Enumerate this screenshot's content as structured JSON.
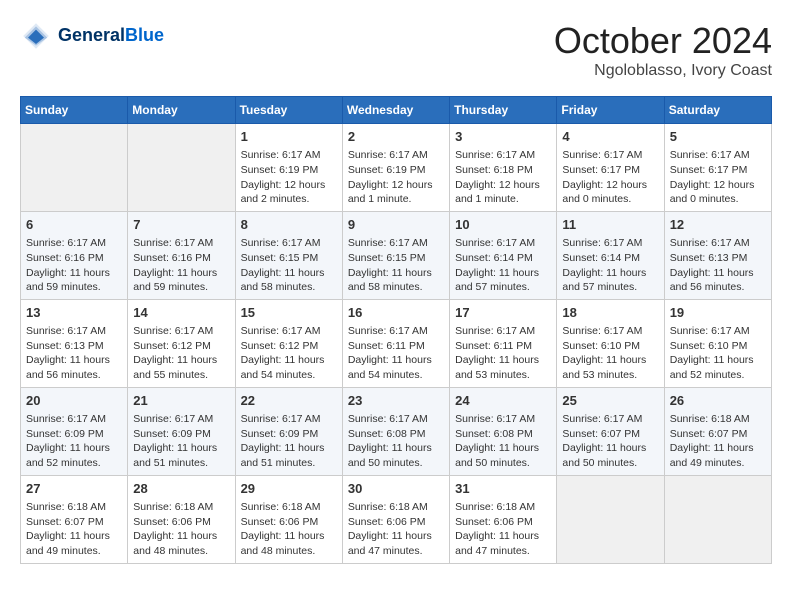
{
  "header": {
    "logo_line1": "General",
    "logo_line2": "Blue",
    "title": "October 2024",
    "subtitle": "Ngoloblasso, Ivory Coast"
  },
  "weekdays": [
    "Sunday",
    "Monday",
    "Tuesday",
    "Wednesday",
    "Thursday",
    "Friday",
    "Saturday"
  ],
  "weeks": [
    [
      {
        "day": "",
        "info": ""
      },
      {
        "day": "",
        "info": ""
      },
      {
        "day": "1",
        "info": "Sunrise: 6:17 AM\nSunset: 6:19 PM\nDaylight: 12 hours\nand 2 minutes."
      },
      {
        "day": "2",
        "info": "Sunrise: 6:17 AM\nSunset: 6:19 PM\nDaylight: 12 hours\nand 1 minute."
      },
      {
        "day": "3",
        "info": "Sunrise: 6:17 AM\nSunset: 6:18 PM\nDaylight: 12 hours\nand 1 minute."
      },
      {
        "day": "4",
        "info": "Sunrise: 6:17 AM\nSunset: 6:17 PM\nDaylight: 12 hours\nand 0 minutes."
      },
      {
        "day": "5",
        "info": "Sunrise: 6:17 AM\nSunset: 6:17 PM\nDaylight: 12 hours\nand 0 minutes."
      }
    ],
    [
      {
        "day": "6",
        "info": "Sunrise: 6:17 AM\nSunset: 6:16 PM\nDaylight: 11 hours\nand 59 minutes."
      },
      {
        "day": "7",
        "info": "Sunrise: 6:17 AM\nSunset: 6:16 PM\nDaylight: 11 hours\nand 59 minutes."
      },
      {
        "day": "8",
        "info": "Sunrise: 6:17 AM\nSunset: 6:15 PM\nDaylight: 11 hours\nand 58 minutes."
      },
      {
        "day": "9",
        "info": "Sunrise: 6:17 AM\nSunset: 6:15 PM\nDaylight: 11 hours\nand 58 minutes."
      },
      {
        "day": "10",
        "info": "Sunrise: 6:17 AM\nSunset: 6:14 PM\nDaylight: 11 hours\nand 57 minutes."
      },
      {
        "day": "11",
        "info": "Sunrise: 6:17 AM\nSunset: 6:14 PM\nDaylight: 11 hours\nand 57 minutes."
      },
      {
        "day": "12",
        "info": "Sunrise: 6:17 AM\nSunset: 6:13 PM\nDaylight: 11 hours\nand 56 minutes."
      }
    ],
    [
      {
        "day": "13",
        "info": "Sunrise: 6:17 AM\nSunset: 6:13 PM\nDaylight: 11 hours\nand 56 minutes."
      },
      {
        "day": "14",
        "info": "Sunrise: 6:17 AM\nSunset: 6:12 PM\nDaylight: 11 hours\nand 55 minutes."
      },
      {
        "day": "15",
        "info": "Sunrise: 6:17 AM\nSunset: 6:12 PM\nDaylight: 11 hours\nand 54 minutes."
      },
      {
        "day": "16",
        "info": "Sunrise: 6:17 AM\nSunset: 6:11 PM\nDaylight: 11 hours\nand 54 minutes."
      },
      {
        "day": "17",
        "info": "Sunrise: 6:17 AM\nSunset: 6:11 PM\nDaylight: 11 hours\nand 53 minutes."
      },
      {
        "day": "18",
        "info": "Sunrise: 6:17 AM\nSunset: 6:10 PM\nDaylight: 11 hours\nand 53 minutes."
      },
      {
        "day": "19",
        "info": "Sunrise: 6:17 AM\nSunset: 6:10 PM\nDaylight: 11 hours\nand 52 minutes."
      }
    ],
    [
      {
        "day": "20",
        "info": "Sunrise: 6:17 AM\nSunset: 6:09 PM\nDaylight: 11 hours\nand 52 minutes."
      },
      {
        "day": "21",
        "info": "Sunrise: 6:17 AM\nSunset: 6:09 PM\nDaylight: 11 hours\nand 51 minutes."
      },
      {
        "day": "22",
        "info": "Sunrise: 6:17 AM\nSunset: 6:09 PM\nDaylight: 11 hours\nand 51 minutes."
      },
      {
        "day": "23",
        "info": "Sunrise: 6:17 AM\nSunset: 6:08 PM\nDaylight: 11 hours\nand 50 minutes."
      },
      {
        "day": "24",
        "info": "Sunrise: 6:17 AM\nSunset: 6:08 PM\nDaylight: 11 hours\nand 50 minutes."
      },
      {
        "day": "25",
        "info": "Sunrise: 6:17 AM\nSunset: 6:07 PM\nDaylight: 11 hours\nand 50 minutes."
      },
      {
        "day": "26",
        "info": "Sunrise: 6:18 AM\nSunset: 6:07 PM\nDaylight: 11 hours\nand 49 minutes."
      }
    ],
    [
      {
        "day": "27",
        "info": "Sunrise: 6:18 AM\nSunset: 6:07 PM\nDaylight: 11 hours\nand 49 minutes."
      },
      {
        "day": "28",
        "info": "Sunrise: 6:18 AM\nSunset: 6:06 PM\nDaylight: 11 hours\nand 48 minutes."
      },
      {
        "day": "29",
        "info": "Sunrise: 6:18 AM\nSunset: 6:06 PM\nDaylight: 11 hours\nand 48 minutes."
      },
      {
        "day": "30",
        "info": "Sunrise: 6:18 AM\nSunset: 6:06 PM\nDaylight: 11 hours\nand 47 minutes."
      },
      {
        "day": "31",
        "info": "Sunrise: 6:18 AM\nSunset: 6:06 PM\nDaylight: 11 hours\nand 47 minutes."
      },
      {
        "day": "",
        "info": ""
      },
      {
        "day": "",
        "info": ""
      }
    ]
  ]
}
